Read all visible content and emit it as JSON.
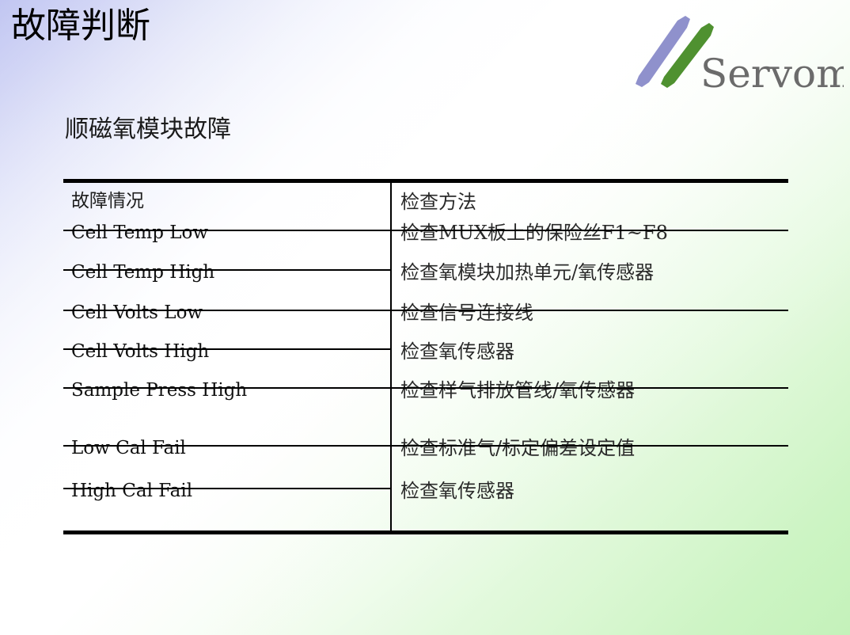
{
  "slide": {
    "title": "故障判断",
    "subtitle": "顺磁氧模块故障",
    "background": {
      "top_left_color": "#c1c6f2",
      "mid_color": "#ffffff",
      "bottom_right_color": "#c4f2ba"
    }
  },
  "logo": {
    "wordmark": "Servomex",
    "slash_purple_color": "#8f91cc",
    "slash_green_color": "#4f9130",
    "wordmark_color": "#6b6b6b"
  },
  "table": {
    "headers": {
      "fault": "故障情况",
      "check": "检查方法"
    },
    "rows": [
      {
        "fault": "Cell Temp Low",
        "check": "检查MUX板上的保险丝F1~F8"
      },
      {
        "fault": "Cell Temp High",
        "check": "检查氧模块加热单元/氧传感器"
      },
      {
        "fault": "Cell Volts Low",
        "check": "检查信号连接线"
      },
      {
        "fault": "Cell Volts High",
        "check": "检查氧传感器"
      },
      {
        "fault": "Sample Press High",
        "check": "检查样气排放管线/氧传感器"
      },
      {
        "fault": "Low Cal Fail",
        "check": "检查标准气/标定偏差设定值"
      },
      {
        "fault": "High Cal Fail",
        "check": "检查氧传感器"
      }
    ]
  }
}
